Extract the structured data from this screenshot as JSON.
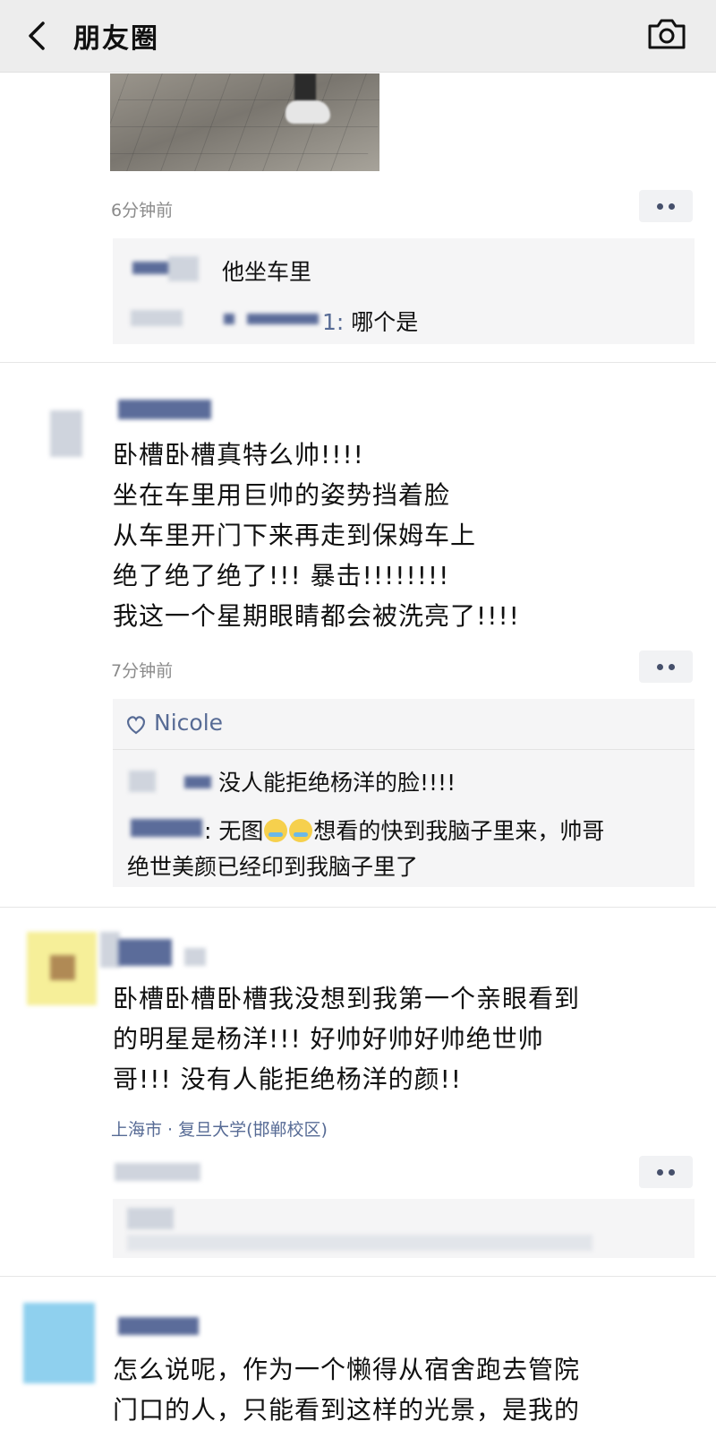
{
  "nav": {
    "title": "朋友圈"
  },
  "moment1": {
    "time": "6分钟前",
    "comments": [
      {
        "text": "他坐车里"
      },
      {
        "name_suffix": "1:",
        "text": "哪个是"
      }
    ]
  },
  "moment2": {
    "lines": [
      "卧槽卧槽真特么帅!!!!",
      "坐在车里用巨帅的姿势挡着脸",
      "从车里开门下来再走到保姆车上",
      "绝了绝了绝了!!! 暴击!!!!!!!!",
      "我这一个星期眼睛都会被洗亮了!!!!"
    ],
    "time": "7分钟前",
    "likes": "Nicole",
    "comments": [
      {
        "text": "没人能拒绝杨洋的脸!!!!"
      },
      {
        "text_a": ": 无图",
        "text_b": "想看的快到我脑子里来，帅哥",
        "text_c": "绝世美颜已经印到我脑子里了"
      }
    ]
  },
  "moment3": {
    "lines": [
      "卧槽卧槽卧槽我没想到我第一个亲眼看到",
      "的明星是杨洋!!! 好帅好帅好帅绝世帅",
      "哥!!! 没有人能拒绝杨洋的颜!!"
    ],
    "location": "上海市 · 复旦大学(邯郸校区)"
  },
  "moment4": {
    "lines": [
      "怎么说呢，作为一个懒得从宿舍跑去管院",
      "门口的人，只能看到这样的光景，是我的"
    ]
  },
  "icons": [
    "back-arrow-icon",
    "camera-icon",
    "more-dots-icon",
    "heart-icon",
    "crying-emoji-icon"
  ],
  "colors": {
    "nav_bg": "#ededed",
    "link": "#576b95",
    "time": "#8b8b8b",
    "comment_bg": "#f5f5f6"
  }
}
